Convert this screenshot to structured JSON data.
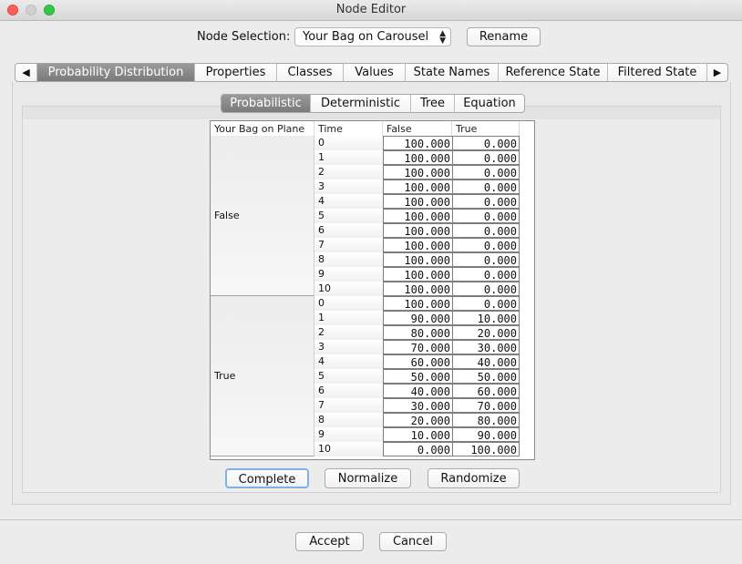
{
  "window": {
    "title": "Node Editor"
  },
  "node_selection": {
    "label": "Node Selection:",
    "value": "Your Bag on Carousel",
    "rename_label": "Rename"
  },
  "tabs": {
    "left_arrow": "◀",
    "right_arrow": "▶",
    "items": [
      "Probability Distribution",
      "Properties",
      "Classes",
      "Values",
      "State Names",
      "Reference State",
      "Filtered State"
    ],
    "active": "Probability Distribution"
  },
  "subtabs": {
    "items": [
      "Probabilistic",
      "Deterministic",
      "Tree",
      "Equation"
    ],
    "active": "Probabilistic"
  },
  "table": {
    "headers": [
      "Your Bag on Plane",
      "Time",
      "False",
      "True"
    ],
    "groups": [
      {
        "label": "False",
        "rows": [
          {
            "time": "0",
            "false": "100.000",
            "true": "0.000"
          },
          {
            "time": "1",
            "false": "100.000",
            "true": "0.000"
          },
          {
            "time": "2",
            "false": "100.000",
            "true": "0.000"
          },
          {
            "time": "3",
            "false": "100.000",
            "true": "0.000"
          },
          {
            "time": "4",
            "false": "100.000",
            "true": "0.000"
          },
          {
            "time": "5",
            "false": "100.000",
            "true": "0.000"
          },
          {
            "time": "6",
            "false": "100.000",
            "true": "0.000"
          },
          {
            "time": "7",
            "false": "100.000",
            "true": "0.000"
          },
          {
            "time": "8",
            "false": "100.000",
            "true": "0.000"
          },
          {
            "time": "9",
            "false": "100.000",
            "true": "0.000"
          },
          {
            "time": "10",
            "false": "100.000",
            "true": "0.000"
          }
        ]
      },
      {
        "label": "True",
        "rows": [
          {
            "time": "0",
            "false": "100.000",
            "true": "0.000"
          },
          {
            "time": "1",
            "false": "90.000",
            "true": "10.000"
          },
          {
            "time": "2",
            "false": "80.000",
            "true": "20.000"
          },
          {
            "time": "3",
            "false": "70.000",
            "true": "30.000"
          },
          {
            "time": "4",
            "false": "60.000",
            "true": "40.000"
          },
          {
            "time": "5",
            "false": "50.000",
            "true": "50.000"
          },
          {
            "time": "6",
            "false": "40.000",
            "true": "60.000"
          },
          {
            "time": "7",
            "false": "30.000",
            "true": "70.000"
          },
          {
            "time": "8",
            "false": "20.000",
            "true": "80.000"
          },
          {
            "time": "9",
            "false": "10.000",
            "true": "90.000"
          },
          {
            "time": "10",
            "false": "0.000",
            "true": "100.000"
          }
        ]
      }
    ]
  },
  "actions": {
    "complete": "Complete",
    "normalize": "Normalize",
    "randomize": "Randomize"
  },
  "footer": {
    "accept": "Accept",
    "cancel": "Cancel"
  }
}
